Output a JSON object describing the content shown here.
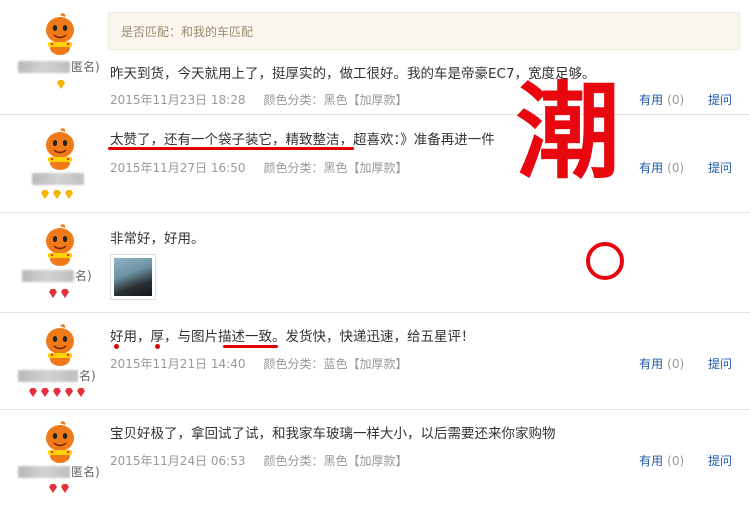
{
  "match_box": {
    "text": "是否匹配：和我的车匹配"
  },
  "overlay_char": "潮",
  "reviews": [
    {
      "user_suffix": "匿名)",
      "content": "昨天到货，今天就用上了，挺厚实的，做工很好。我的车是帝豪EC7，宽度足够。",
      "date": "2015年11月23日 18:28",
      "variant": "颜色分类：黑色【加厚款】",
      "useful": "有用",
      "useful_count": "(0)",
      "ask": "提问",
      "badge_color": "#f5b400",
      "badge_count": 1
    },
    {
      "user_suffix": "",
      "content_parts": [
        "太赞了，还有一个袋子装它，精致整洁",
        "，超喜欢：》准备再进一件"
      ],
      "date": "2015年11月27日 16:50",
      "variant": "颜色分类：黑色【加厚款】",
      "useful": "有用",
      "useful_count": "(0)",
      "ask": "提问",
      "badge_color": "#f5b400",
      "badge_count": 3
    },
    {
      "user_suffix": "名)",
      "content": "非常好，好用。",
      "badge_color": "#e5313a",
      "badge_count": 2
    },
    {
      "user_suffix": "名)",
      "content_parts": [
        "好用，厚，与图片",
        "描述一致",
        "。发货快，快递迅速，给五星评！"
      ],
      "date": "2015年11月21日 14:40",
      "variant": "颜色分类：蓝色【加厚款】",
      "useful": "有用",
      "useful_count": "(0)",
      "ask": "提问",
      "badge_color": "#e5313a",
      "badge_count": 5
    },
    {
      "user_suffix": "匿名)",
      "content": "宝贝好极了，拿回试了试，和我家车玻璃一样大小，以后需要还来你家购物",
      "date": "2015年11月24日 06:53",
      "variant": "颜色分类：黑色【加厚款】",
      "useful": "有用",
      "useful_count": "(0)",
      "ask": "提问",
      "badge_color": "#e5313a",
      "badge_count": 2
    }
  ],
  "colors": {
    "accent_link": "#1e5aa8",
    "annotation_red": "#e8070e",
    "meta_gray": "#999999"
  }
}
